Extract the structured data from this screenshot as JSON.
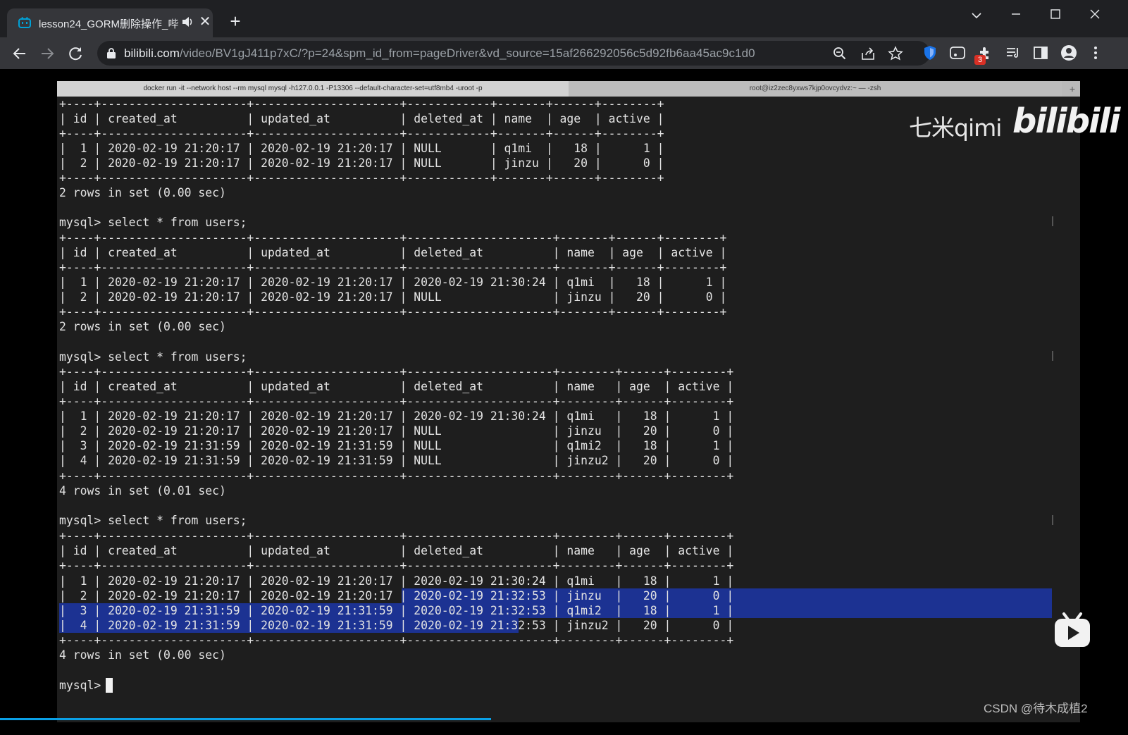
{
  "browser": {
    "tab_title": "lesson24_GORM删除操作_哔",
    "url_host": "bilibili.com",
    "url_path": "/video/BV1gJ411p7xC/?p=24&spm_id_from=pageDriver&vd_source=15af266292056c5d92fb6aa45ac9c1d0",
    "extension_badge": "3",
    "colors": {
      "tabbar": "#1f2023",
      "toolbar": "#35363a",
      "omnibox": "#202124",
      "accent": "#00a1d6"
    }
  },
  "terminal": {
    "tabs": [
      "docker run -it --network host --rm mysql mysql -h127.0.0.1 -P13306 --default-character-set=utf8mb4 -uroot -p",
      "root@iz2zec8yxws7kjp0ovcydvz:~ — -zsh"
    ],
    "lines": [
      "+----+---------------------+---------------------+------------+-------+------+--------+",
      "| id | created_at          | updated_at          | deleted_at | name  | age  | active |",
      "+----+---------------------+---------------------+------------+-------+------+--------+",
      "|  1 | 2020-02-19 21:20:17 | 2020-02-19 21:20:17 | NULL       | q1mi  |   18 |      1 |",
      "|  2 | 2020-02-19 21:20:17 | 2020-02-19 21:20:17 | NULL       | jinzu |   20 |      0 |",
      "+----+---------------------+---------------------+------------+-------+------+--------+",
      "2 rows in set (0.00 sec)",
      "",
      "mysql> select * from users;",
      "+----+---------------------+---------------------+---------------------+-------+------+--------+",
      "| id | created_at          | updated_at          | deleted_at          | name  | age  | active |",
      "+----+---------------------+---------------------+---------------------+-------+------+--------+",
      "|  1 | 2020-02-19 21:20:17 | 2020-02-19 21:20:17 | 2020-02-19 21:30:24 | q1mi  |   18 |      1 |",
      "|  2 | 2020-02-19 21:20:17 | 2020-02-19 21:20:17 | NULL                | jinzu |   20 |      0 |",
      "+----+---------------------+---------------------+---------------------+-------+------+--------+",
      "2 rows in set (0.00 sec)",
      "",
      "mysql> select * from users;",
      "+----+---------------------+---------------------+---------------------+--------+------+--------+",
      "| id | created_at          | updated_at          | deleted_at          | name   | age  | active |",
      "+----+---------------------+---------------------+---------------------+--------+------+--------+",
      "|  1 | 2020-02-19 21:20:17 | 2020-02-19 21:20:17 | 2020-02-19 21:30:24 | q1mi   |   18 |      1 |",
      "|  2 | 2020-02-19 21:20:17 | 2020-02-19 21:20:17 | NULL                | jinzu  |   20 |      0 |",
      "|  3 | 2020-02-19 21:31:59 | 2020-02-19 21:31:59 | NULL                | q1mi2  |   18 |      1 |",
      "|  4 | 2020-02-19 21:31:59 | 2020-02-19 21:31:59 | NULL                | jinzu2 |   20 |      0 |",
      "+----+---------------------+---------------------+---------------------+--------+------+--------+",
      "4 rows in set (0.01 sec)",
      "",
      "mysql> select * from users;",
      "+----+---------------------+---------------------+---------------------+--------+------+--------+",
      "| id | created_at          | updated_at          | deleted_at          | name   | age  | active |",
      "+----+---------------------+---------------------+---------------------+--------+------+--------+",
      "|  1 | 2020-02-19 21:20:17 | 2020-02-19 21:20:17 | 2020-02-19 21:30:24 | q1mi   |   18 |      1 |",
      "|  2 | 2020-02-19 21:20:17 | 2020-02-19 21:20:17 | 2020-02-19 21:32:53 | jinzu  |   20 |      0 |",
      "|  3 | 2020-02-19 21:31:59 | 2020-02-19 21:31:59 | 2020-02-19 21:32:53 | q1mi2  |   18 |      1 |",
      "|  4 | 2020-02-19 21:31:59 | 2020-02-19 21:31:59 | 2020-02-19 21:32:53 | jinzu2 |   20 |      0 |",
      "+----+---------------------+---------------------+---------------------+--------+------+--------+",
      "4 rows in set (0.00 sec)",
      "",
      "mysql> "
    ],
    "colors": {
      "background": "#1e1e1e",
      "text": "#e3e3e3",
      "selection": "#1c3292"
    }
  },
  "watermark": {
    "author": "七米qimi",
    "site": "bilibili",
    "csdn": "CSDN @待木成植2"
  },
  "player": {
    "progress_color": "#0aa0e6"
  }
}
